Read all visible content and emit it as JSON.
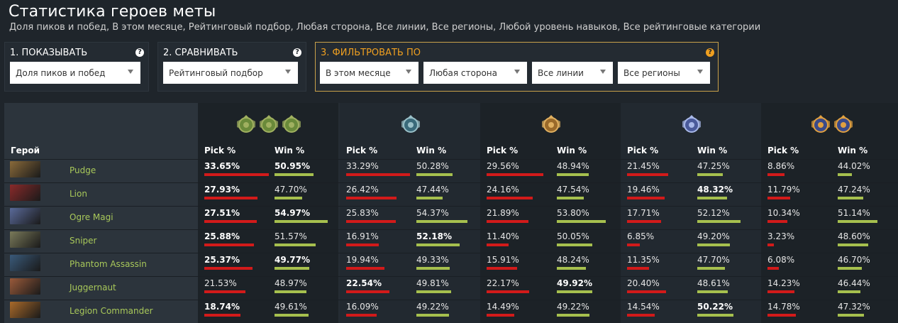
{
  "header": {
    "title": "Статистика героев меты",
    "subtitle": "Доля пиков и побед, В этом месяце, Рейтинговый подбор, Любая сторона, Все линии, Все регионы, Любой уровень навыков, Все рейтинговые категории"
  },
  "panels": {
    "show": {
      "title": "1. ПОКАЗЫВАТЬ",
      "value": "Доля пиков и побед"
    },
    "compare": {
      "title": "2. СРАВНИВАТЬ",
      "value": "Рейтинговый подбор"
    },
    "filter": {
      "title": "3. ФИЛЬТРОВАТЬ ПО",
      "period": "В этом месяце",
      "side": "Любая сторона",
      "lanes": "Все линии",
      "regions": "Все регионы"
    },
    "help_symbol": "?"
  },
  "table": {
    "hero_header": "Герой",
    "pick_header": "Pick %",
    "win_header": "Win %",
    "colors": {
      "pick_bar": "#d21a1a",
      "win_bar": "#a6c04e",
      "hero_name": "#a8c85a"
    },
    "rank_groups": [
      {
        "icons": [
          "herald-guardian-crusader-medal-icon"
        ]
      },
      {
        "icons": [
          "archon-medal-icon"
        ]
      },
      {
        "icons": [
          "legend-medal-icon"
        ]
      },
      {
        "icons": [
          "ancient-medal-icon"
        ]
      },
      {
        "icons": [
          "divine-immortal-medal-icon"
        ]
      }
    ],
    "rows": [
      {
        "hero": "Pudge",
        "portrait_color": "#8a6a3a",
        "cells": [
          {
            "pick": "33.65%",
            "win": "50.95%",
            "pick_bold": true,
            "win_bold": true,
            "pick_val": 33.65,
            "win_val": 50.95
          },
          {
            "pick": "33.29%",
            "win": "50.28%",
            "pick_bold": false,
            "win_bold": false,
            "pick_val": 33.29,
            "win_val": 50.28
          },
          {
            "pick": "29.56%",
            "win": "48.94%",
            "pick_bold": false,
            "win_bold": false,
            "pick_val": 29.56,
            "win_val": 48.94
          },
          {
            "pick": "21.45%",
            "win": "47.25%",
            "pick_bold": false,
            "win_bold": false,
            "pick_val": 21.45,
            "win_val": 47.25
          },
          {
            "pick": "8.86%",
            "win": "44.02%",
            "pick_bold": false,
            "win_bold": false,
            "pick_val": 8.86,
            "win_val": 44.02
          }
        ]
      },
      {
        "hero": "Lion",
        "portrait_color": "#8a2a2a",
        "cells": [
          {
            "pick": "27.93%",
            "win": "47.70%",
            "pick_bold": true,
            "win_bold": false,
            "pick_val": 27.93,
            "win_val": 47.7
          },
          {
            "pick": "26.42%",
            "win": "47.44%",
            "pick_bold": false,
            "win_bold": false,
            "pick_val": 26.42,
            "win_val": 47.44
          },
          {
            "pick": "24.16%",
            "win": "47.54%",
            "pick_bold": false,
            "win_bold": false,
            "pick_val": 24.16,
            "win_val": 47.54
          },
          {
            "pick": "19.46%",
            "win": "48.32%",
            "pick_bold": false,
            "win_bold": true,
            "pick_val": 19.46,
            "win_val": 48.32
          },
          {
            "pick": "11.79%",
            "win": "47.24%",
            "pick_bold": false,
            "win_bold": false,
            "pick_val": 11.79,
            "win_val": 47.24
          }
        ]
      },
      {
        "hero": "Ogre Magi",
        "portrait_color": "#5a6a9a",
        "cells": [
          {
            "pick": "27.51%",
            "win": "54.97%",
            "pick_bold": true,
            "win_bold": true,
            "pick_val": 27.51,
            "win_val": 54.97
          },
          {
            "pick": "25.83%",
            "win": "54.37%",
            "pick_bold": false,
            "win_bold": false,
            "pick_val": 25.83,
            "win_val": 54.37
          },
          {
            "pick": "21.89%",
            "win": "53.80%",
            "pick_bold": false,
            "win_bold": false,
            "pick_val": 21.89,
            "win_val": 53.8
          },
          {
            "pick": "17.71%",
            "win": "52.12%",
            "pick_bold": false,
            "win_bold": false,
            "pick_val": 17.71,
            "win_val": 52.12
          },
          {
            "pick": "10.34%",
            "win": "51.14%",
            "pick_bold": false,
            "win_bold": false,
            "pick_val": 10.34,
            "win_val": 51.14
          }
        ]
      },
      {
        "hero": "Sniper",
        "portrait_color": "#7a7a5a",
        "cells": [
          {
            "pick": "25.88%",
            "win": "51.57%",
            "pick_bold": true,
            "win_bold": false,
            "pick_val": 25.88,
            "win_val": 51.57
          },
          {
            "pick": "16.91%",
            "win": "52.18%",
            "pick_bold": false,
            "win_bold": true,
            "pick_val": 16.91,
            "win_val": 52.18
          },
          {
            "pick": "11.40%",
            "win": "50.05%",
            "pick_bold": false,
            "win_bold": false,
            "pick_val": 11.4,
            "win_val": 50.05
          },
          {
            "pick": "6.85%",
            "win": "49.20%",
            "pick_bold": false,
            "win_bold": false,
            "pick_val": 6.85,
            "win_val": 49.2
          },
          {
            "pick": "3.23%",
            "win": "48.60%",
            "pick_bold": false,
            "win_bold": false,
            "pick_val": 3.23,
            "win_val": 48.6
          }
        ]
      },
      {
        "hero": "Phantom Assassin",
        "portrait_color": "#3a5a7a",
        "cells": [
          {
            "pick": "25.37%",
            "win": "49.77%",
            "pick_bold": true,
            "win_bold": true,
            "pick_val": 25.37,
            "win_val": 49.77
          },
          {
            "pick": "19.94%",
            "win": "49.33%",
            "pick_bold": false,
            "win_bold": false,
            "pick_val": 19.94,
            "win_val": 49.33
          },
          {
            "pick": "15.91%",
            "win": "48.24%",
            "pick_bold": false,
            "win_bold": false,
            "pick_val": 15.91,
            "win_val": 48.24
          },
          {
            "pick": "11.35%",
            "win": "47.70%",
            "pick_bold": false,
            "win_bold": false,
            "pick_val": 11.35,
            "win_val": 47.7
          },
          {
            "pick": "6.08%",
            "win": "46.70%",
            "pick_bold": false,
            "win_bold": false,
            "pick_val": 6.08,
            "win_val": 46.7
          }
        ]
      },
      {
        "hero": "Juggernaut",
        "portrait_color": "#9a5a3a",
        "cells": [
          {
            "pick": "21.53%",
            "win": "48.97%",
            "pick_bold": false,
            "win_bold": false,
            "pick_val": 21.53,
            "win_val": 48.97
          },
          {
            "pick": "22.54%",
            "win": "49.81%",
            "pick_bold": true,
            "win_bold": false,
            "pick_val": 22.54,
            "win_val": 49.81
          },
          {
            "pick": "22.17%",
            "win": "49.92%",
            "pick_bold": false,
            "win_bold": true,
            "pick_val": 22.17,
            "win_val": 49.92
          },
          {
            "pick": "20.40%",
            "win": "48.61%",
            "pick_bold": false,
            "win_bold": false,
            "pick_val": 20.4,
            "win_val": 48.61
          },
          {
            "pick": "14.23%",
            "win": "46.44%",
            "pick_bold": false,
            "win_bold": false,
            "pick_val": 14.23,
            "win_val": 46.44
          }
        ]
      },
      {
        "hero": "Legion Commander",
        "portrait_color": "#aa6a2a",
        "cells": [
          {
            "pick": "18.74%",
            "win": "49.61%",
            "pick_bold": true,
            "win_bold": false,
            "pick_val": 18.74,
            "win_val": 49.61
          },
          {
            "pick": "16.09%",
            "win": "49.22%",
            "pick_bold": false,
            "win_bold": false,
            "pick_val": 16.09,
            "win_val": 49.22
          },
          {
            "pick": "14.49%",
            "win": "49.22%",
            "pick_bold": false,
            "win_bold": false,
            "pick_val": 14.49,
            "win_val": 49.22
          },
          {
            "pick": "14.54%",
            "win": "50.22%",
            "pick_bold": false,
            "win_bold": true,
            "pick_val": 14.54,
            "win_val": 50.22
          },
          {
            "pick": "14.78%",
            "win": "47.32%",
            "pick_bold": false,
            "win_bold": false,
            "pick_val": 14.78,
            "win_val": 47.32
          }
        ]
      }
    ]
  }
}
